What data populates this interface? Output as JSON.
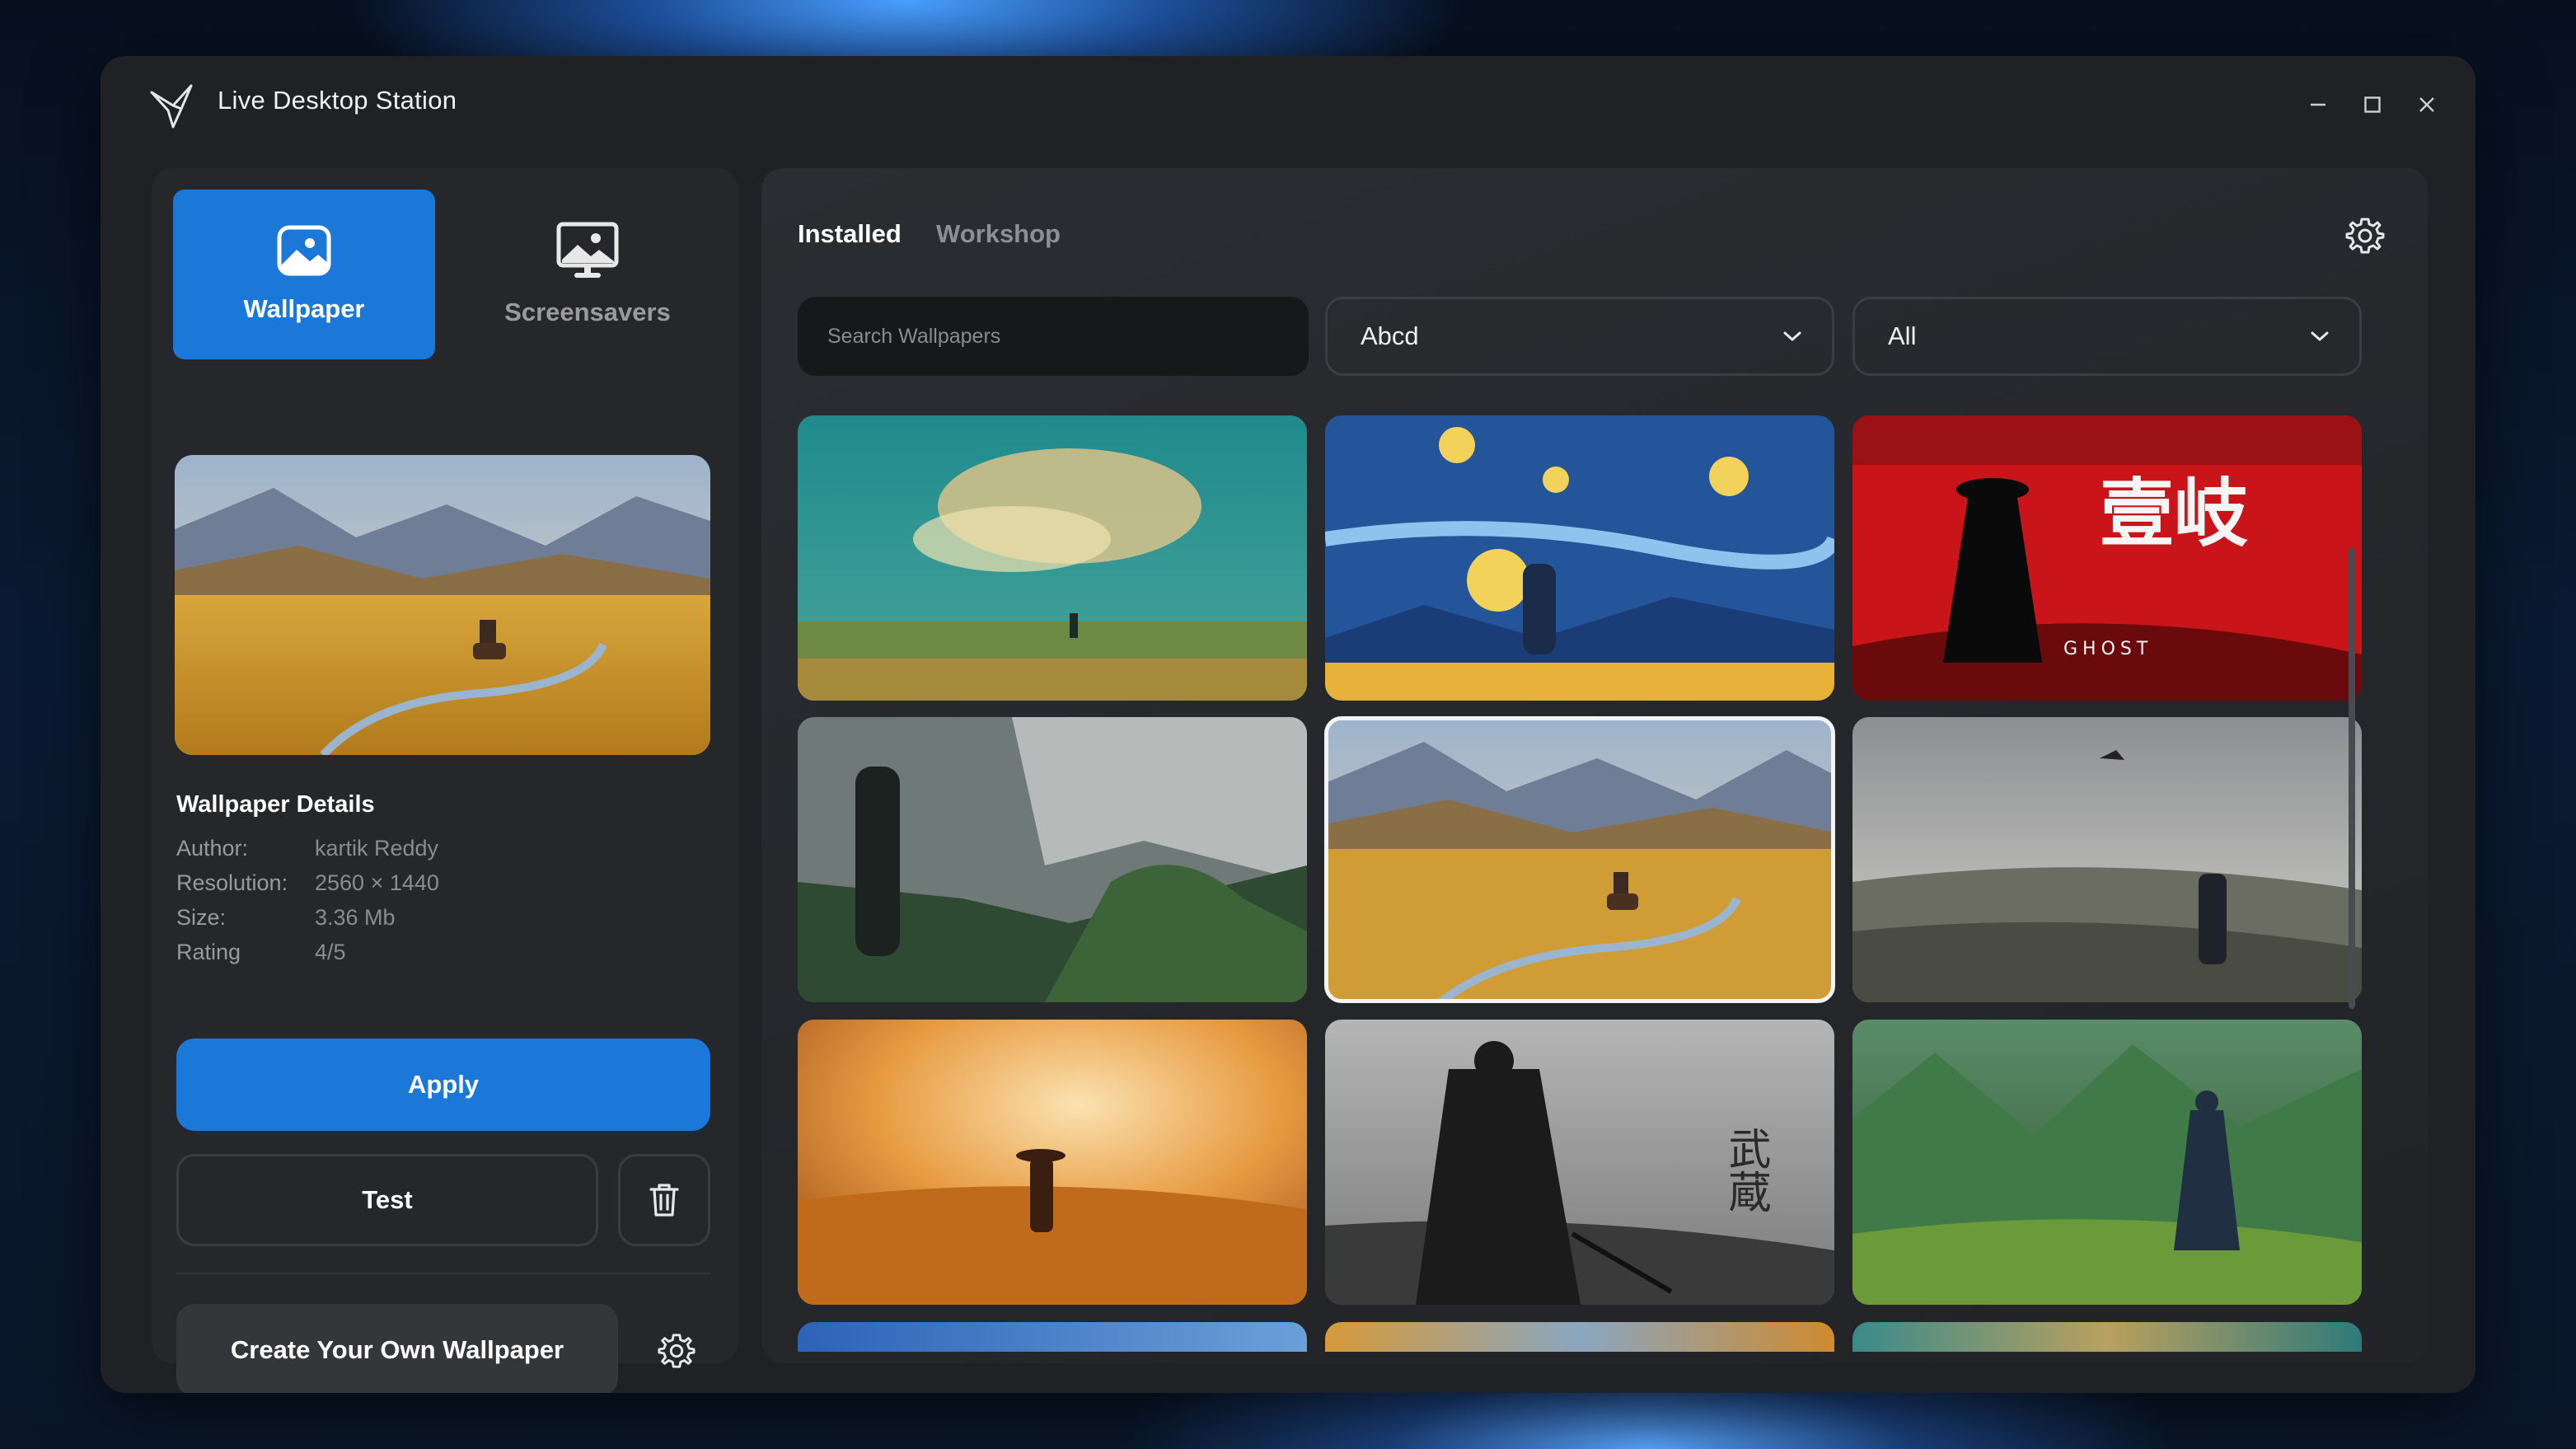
{
  "app": {
    "title": "Live Desktop Station",
    "icon": "hummingbird-logo-icon"
  },
  "window_controls": [
    {
      "name": "minimize-button",
      "icon": "minimize-icon",
      "symbol": "–"
    },
    {
      "name": "maximize-button",
      "icon": "maximize-icon",
      "symbol": "☐"
    },
    {
      "name": "close-button",
      "icon": "close-icon",
      "symbol": "✕"
    }
  ],
  "sidebar": {
    "modes": [
      {
        "label": "Wallpaper",
        "icon": "image-icon",
        "active": true
      },
      {
        "label": "Screensavers",
        "icon": "monitor-image-icon",
        "active": false
      }
    ],
    "preview": {
      "scene": "golden-valley-rider"
    },
    "details": {
      "title": "Wallpaper Details",
      "rows": [
        {
          "key": "Author:",
          "value": "kartik Reddy"
        },
        {
          "key": "Resolution:",
          "value": "2560 × 1440"
        },
        {
          "key": "Size:",
          "value": "3.36 Mb"
        },
        {
          "key": "Rating",
          "value": "4/5"
        }
      ]
    },
    "apply_label": "Apply",
    "test_label": "Test",
    "delete_icon": "trash-icon",
    "create_label": "Create Your Own Wallpaper",
    "create_settings_icon": "gear-icon"
  },
  "main": {
    "tabs": [
      {
        "label": "Installed",
        "active": true
      },
      {
        "label": "Workshop",
        "active": false
      }
    ],
    "settings_icon": "gear-icon",
    "search": {
      "placeholder": "Search Wallpapers",
      "value": ""
    },
    "filters": [
      {
        "value": "Abcd",
        "icon": "chevron-down-icon"
      },
      {
        "value": "All",
        "icon": "chevron-down-icon"
      }
    ],
    "wallpapers": [
      {
        "scene": "teal-sky-clouds-field",
        "selected": false
      },
      {
        "scene": "starry-night-wanderer",
        "selected": false
      },
      {
        "scene": "red-ghost-samurai",
        "selected": false,
        "overlay_text": "壹岐",
        "overlay_sub": "GHOST"
      },
      {
        "scene": "misty-forest-samurai",
        "selected": false
      },
      {
        "scene": "golden-valley-rider",
        "selected": true
      },
      {
        "scene": "grey-field-warrior",
        "selected": false
      },
      {
        "scene": "orange-haze-ronin",
        "selected": false
      },
      {
        "scene": "monochrome-swordsman",
        "selected": false,
        "overlay_text": "武蔵"
      },
      {
        "scene": "green-mountain-cloak",
        "selected": false
      }
    ]
  },
  "colors": {
    "accent": "#1b78d9",
    "window_bg": "#202124",
    "panel_bg": "#26272a"
  }
}
